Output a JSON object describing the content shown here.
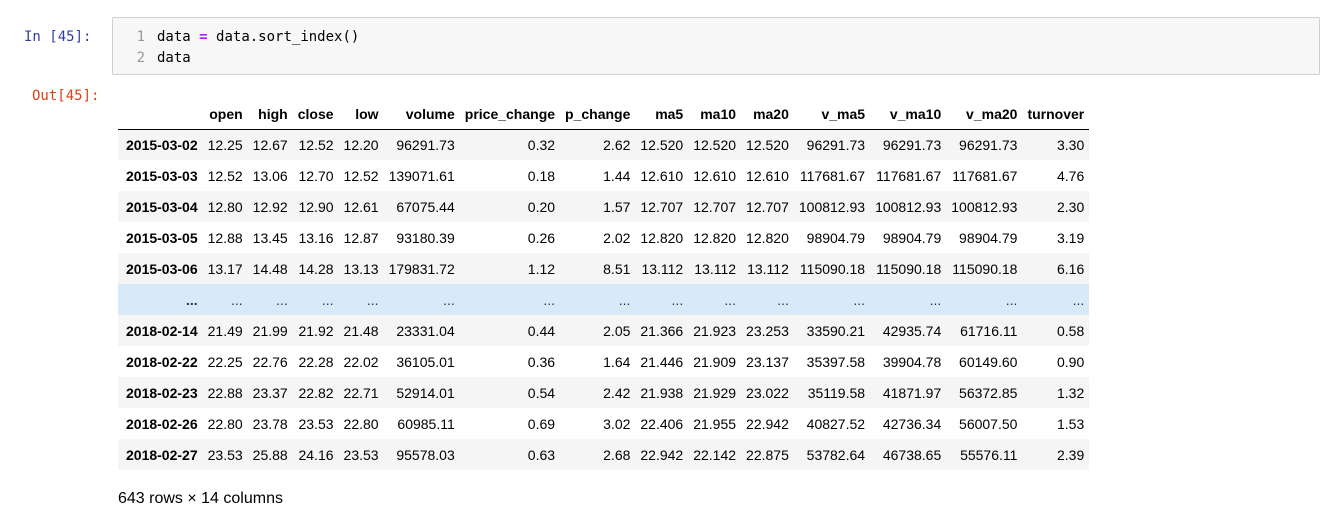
{
  "cell": {
    "in_prompt": "In  [45]:",
    "out_prompt": "Out[45]:",
    "lines": [
      {
        "num": "1",
        "var": "data",
        "op": "=",
        "rest": "data.sort_index()"
      },
      {
        "num": "2",
        "text": "data"
      }
    ]
  },
  "dataframe": {
    "index_header": "",
    "columns": [
      "open",
      "high",
      "close",
      "low",
      "volume",
      "price_change",
      "p_change",
      "ma5",
      "ma10",
      "ma20",
      "v_ma5",
      "v_ma10",
      "v_ma20",
      "turnover"
    ],
    "rows": [
      {
        "index": "2015-03-02",
        "values": [
          "12.25",
          "12.67",
          "12.52",
          "12.20",
          "96291.73",
          "0.32",
          "2.62",
          "12.520",
          "12.520",
          "12.520",
          "96291.73",
          "96291.73",
          "96291.73",
          "3.30"
        ]
      },
      {
        "index": "2015-03-03",
        "values": [
          "12.52",
          "13.06",
          "12.70",
          "12.52",
          "139071.61",
          "0.18",
          "1.44",
          "12.610",
          "12.610",
          "12.610",
          "117681.67",
          "117681.67",
          "117681.67",
          "4.76"
        ]
      },
      {
        "index": "2015-03-04",
        "values": [
          "12.80",
          "12.92",
          "12.90",
          "12.61",
          "67075.44",
          "0.20",
          "1.57",
          "12.707",
          "12.707",
          "12.707",
          "100812.93",
          "100812.93",
          "100812.93",
          "2.30"
        ]
      },
      {
        "index": "2015-03-05",
        "values": [
          "12.88",
          "13.45",
          "13.16",
          "12.87",
          "93180.39",
          "0.26",
          "2.02",
          "12.820",
          "12.820",
          "12.820",
          "98904.79",
          "98904.79",
          "98904.79",
          "3.19"
        ]
      },
      {
        "index": "2015-03-06",
        "values": [
          "13.17",
          "14.48",
          "14.28",
          "13.13",
          "179831.72",
          "1.12",
          "8.51",
          "13.112",
          "13.112",
          "13.112",
          "115090.18",
          "115090.18",
          "115090.18",
          "6.16"
        ]
      },
      {
        "index": "...",
        "ellipsis": true,
        "values": [
          "...",
          "...",
          "...",
          "...",
          "...",
          "...",
          "...",
          "...",
          "...",
          "...",
          "...",
          "...",
          "...",
          "..."
        ]
      },
      {
        "index": "2018-02-14",
        "values": [
          "21.49",
          "21.99",
          "21.92",
          "21.48",
          "23331.04",
          "0.44",
          "2.05",
          "21.366",
          "21.923",
          "23.253",
          "33590.21",
          "42935.74",
          "61716.11",
          "0.58"
        ]
      },
      {
        "index": "2018-02-22",
        "values": [
          "22.25",
          "22.76",
          "22.28",
          "22.02",
          "36105.01",
          "0.36",
          "1.64",
          "21.446",
          "21.909",
          "23.137",
          "35397.58",
          "39904.78",
          "60149.60",
          "0.90"
        ]
      },
      {
        "index": "2018-02-23",
        "values": [
          "22.88",
          "23.37",
          "22.82",
          "22.71",
          "52914.01",
          "0.54",
          "2.42",
          "21.938",
          "21.929",
          "23.022",
          "35119.58",
          "41871.97",
          "56372.85",
          "1.32"
        ]
      },
      {
        "index": "2018-02-26",
        "values": [
          "22.80",
          "23.78",
          "23.53",
          "22.80",
          "60985.11",
          "0.69",
          "3.02",
          "22.406",
          "21.955",
          "22.942",
          "40827.52",
          "42736.34",
          "56007.50",
          "1.53"
        ]
      },
      {
        "index": "2018-02-27",
        "values": [
          "23.53",
          "25.88",
          "24.16",
          "23.53",
          "95578.03",
          "0.63",
          "2.68",
          "22.942",
          "22.142",
          "22.875",
          "53782.64",
          "46738.65",
          "55576.11",
          "2.39"
        ]
      }
    ],
    "shape_text": "643 rows × 14 columns"
  }
}
